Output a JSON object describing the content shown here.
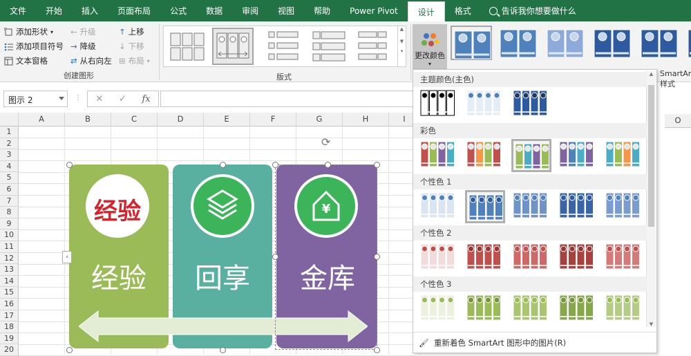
{
  "tabs": [
    {
      "label": "文件",
      "active": false
    },
    {
      "label": "开始",
      "active": false
    },
    {
      "label": "插入",
      "active": false
    },
    {
      "label": "页面布局",
      "active": false
    },
    {
      "label": "公式",
      "active": false
    },
    {
      "label": "数据",
      "active": false
    },
    {
      "label": "审阅",
      "active": false
    },
    {
      "label": "视图",
      "active": false
    },
    {
      "label": "帮助",
      "active": false
    },
    {
      "label": "Power Pivot",
      "active": false
    },
    {
      "label": "设计",
      "active": true
    },
    {
      "label": "格式",
      "active": false
    }
  ],
  "tell_me": "告诉我你想要做什么",
  "create_graphic": {
    "add_shape": "添加形状",
    "add_bullet": "添加项目符号",
    "text_pane": "文本窗格",
    "promote": "升级",
    "demote": "降级",
    "right_to_left": "从右向左",
    "move_up": "上移",
    "move_down": "下移",
    "layout": "布局",
    "group_label": "创建图形"
  },
  "layouts": {
    "group_label": "版式"
  },
  "change_colors": "更改颜色",
  "styles_label": "SmartArt 样式",
  "formula_bar": {
    "name_box": "图示 2",
    "cancel": "✕",
    "confirm": "✓",
    "fx": "fx"
  },
  "columns": [
    "A",
    "B",
    "C",
    "D",
    "E",
    "F",
    "G",
    "H",
    "I"
  ],
  "rows": [
    "1",
    "2",
    "3",
    "4",
    "5",
    "6",
    "7",
    "8",
    "9",
    "10",
    "11",
    "12",
    "13",
    "14",
    "15",
    "16",
    "17",
    "18",
    "19",
    "20"
  ],
  "far_right_column": "O",
  "smartart": {
    "panels": [
      {
        "text": "经验",
        "color": "#9bbb59",
        "logo_text": "经验"
      },
      {
        "text": "回享",
        "color": "#5ab0a0"
      },
      {
        "text": "金库",
        "color": "#8064a2"
      }
    ],
    "house_symbol": "¥"
  },
  "color_menu": {
    "sections": [
      {
        "label": "主题颜色(主色)"
      },
      {
        "label": "彩色"
      },
      {
        "label": "个性色 1"
      },
      {
        "label": "个性色 2"
      },
      {
        "label": "个性色 3"
      }
    ],
    "footer": "重新着色 SmartArt 图形中的图片(R)"
  },
  "colors": {
    "excel_green": "#217346",
    "accent_blue": "#4f81bd",
    "accent_red": "#c0504d",
    "accent_green": "#9bbb59",
    "accent_purple": "#8064a2",
    "accent_teal": "#4bacc6",
    "accent_orange": "#f79646"
  }
}
